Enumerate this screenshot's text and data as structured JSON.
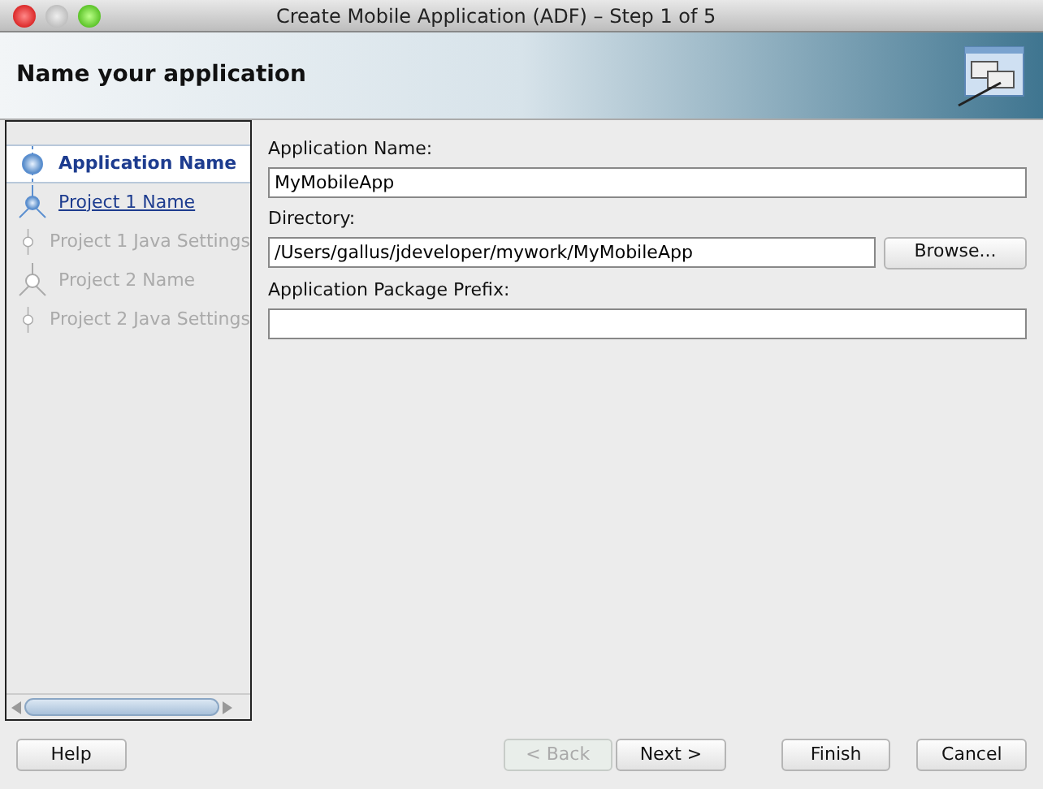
{
  "window": {
    "title": "Create Mobile Application (ADF) – Step 1 of 5"
  },
  "header": {
    "title": "Name your application"
  },
  "steps": [
    {
      "label": "Application Name",
      "kind": "node",
      "selected": true,
      "disabled": false
    },
    {
      "label": "Project 1 Name",
      "kind": "fork",
      "selected": false,
      "disabled": false
    },
    {
      "label": "Project 1 Java Settings",
      "kind": "node",
      "selected": false,
      "disabled": true
    },
    {
      "label": "Project 2 Name",
      "kind": "fork",
      "selected": false,
      "disabled": true
    },
    {
      "label": "Project 2 Java Settings",
      "kind": "node",
      "selected": false,
      "disabled": true
    }
  ],
  "fields": [
    {
      "label": "Application Name:",
      "value": "MyMobileApp"
    },
    {
      "label": "Directory:",
      "value": "/Users/gallus/jdeveloper/mywork/MyMobileApp",
      "button": "Browse..."
    },
    {
      "label": "Application Package Prefix:"
    }
  ],
  "buttons": [
    {
      "label": "Help",
      "disabled": false
    },
    {
      "label": "< Back",
      "disabled": true
    },
    {
      "label": "Next >",
      "disabled": false
    },
    {
      "label": "Finish",
      "disabled": false
    },
    {
      "label": "Cancel",
      "disabled": false
    }
  ]
}
